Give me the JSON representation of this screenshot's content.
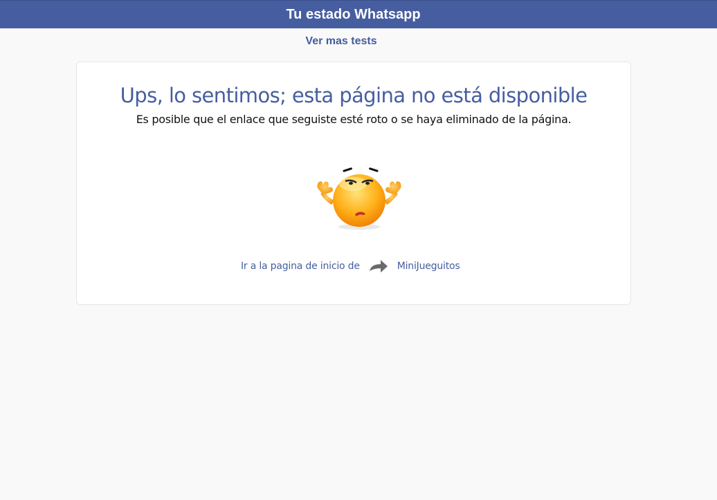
{
  "header": {
    "title": "Tu estado Whatsapp",
    "color": "#465ea0"
  },
  "nav": {
    "more_tests_label": "Ver mas tests"
  },
  "error": {
    "title": "Ups, lo sentimos; esta página no está disponible",
    "subtitle": "Es posible que el enlace que seguiste esté roto o se haya eliminado de la página.",
    "illustration": "confused-emoji-icon"
  },
  "home": {
    "prefix": "Ir a la pagina de inicio de",
    "arrow_icon": "arrow-right-icon",
    "link_label": "MiniJueguitos"
  }
}
